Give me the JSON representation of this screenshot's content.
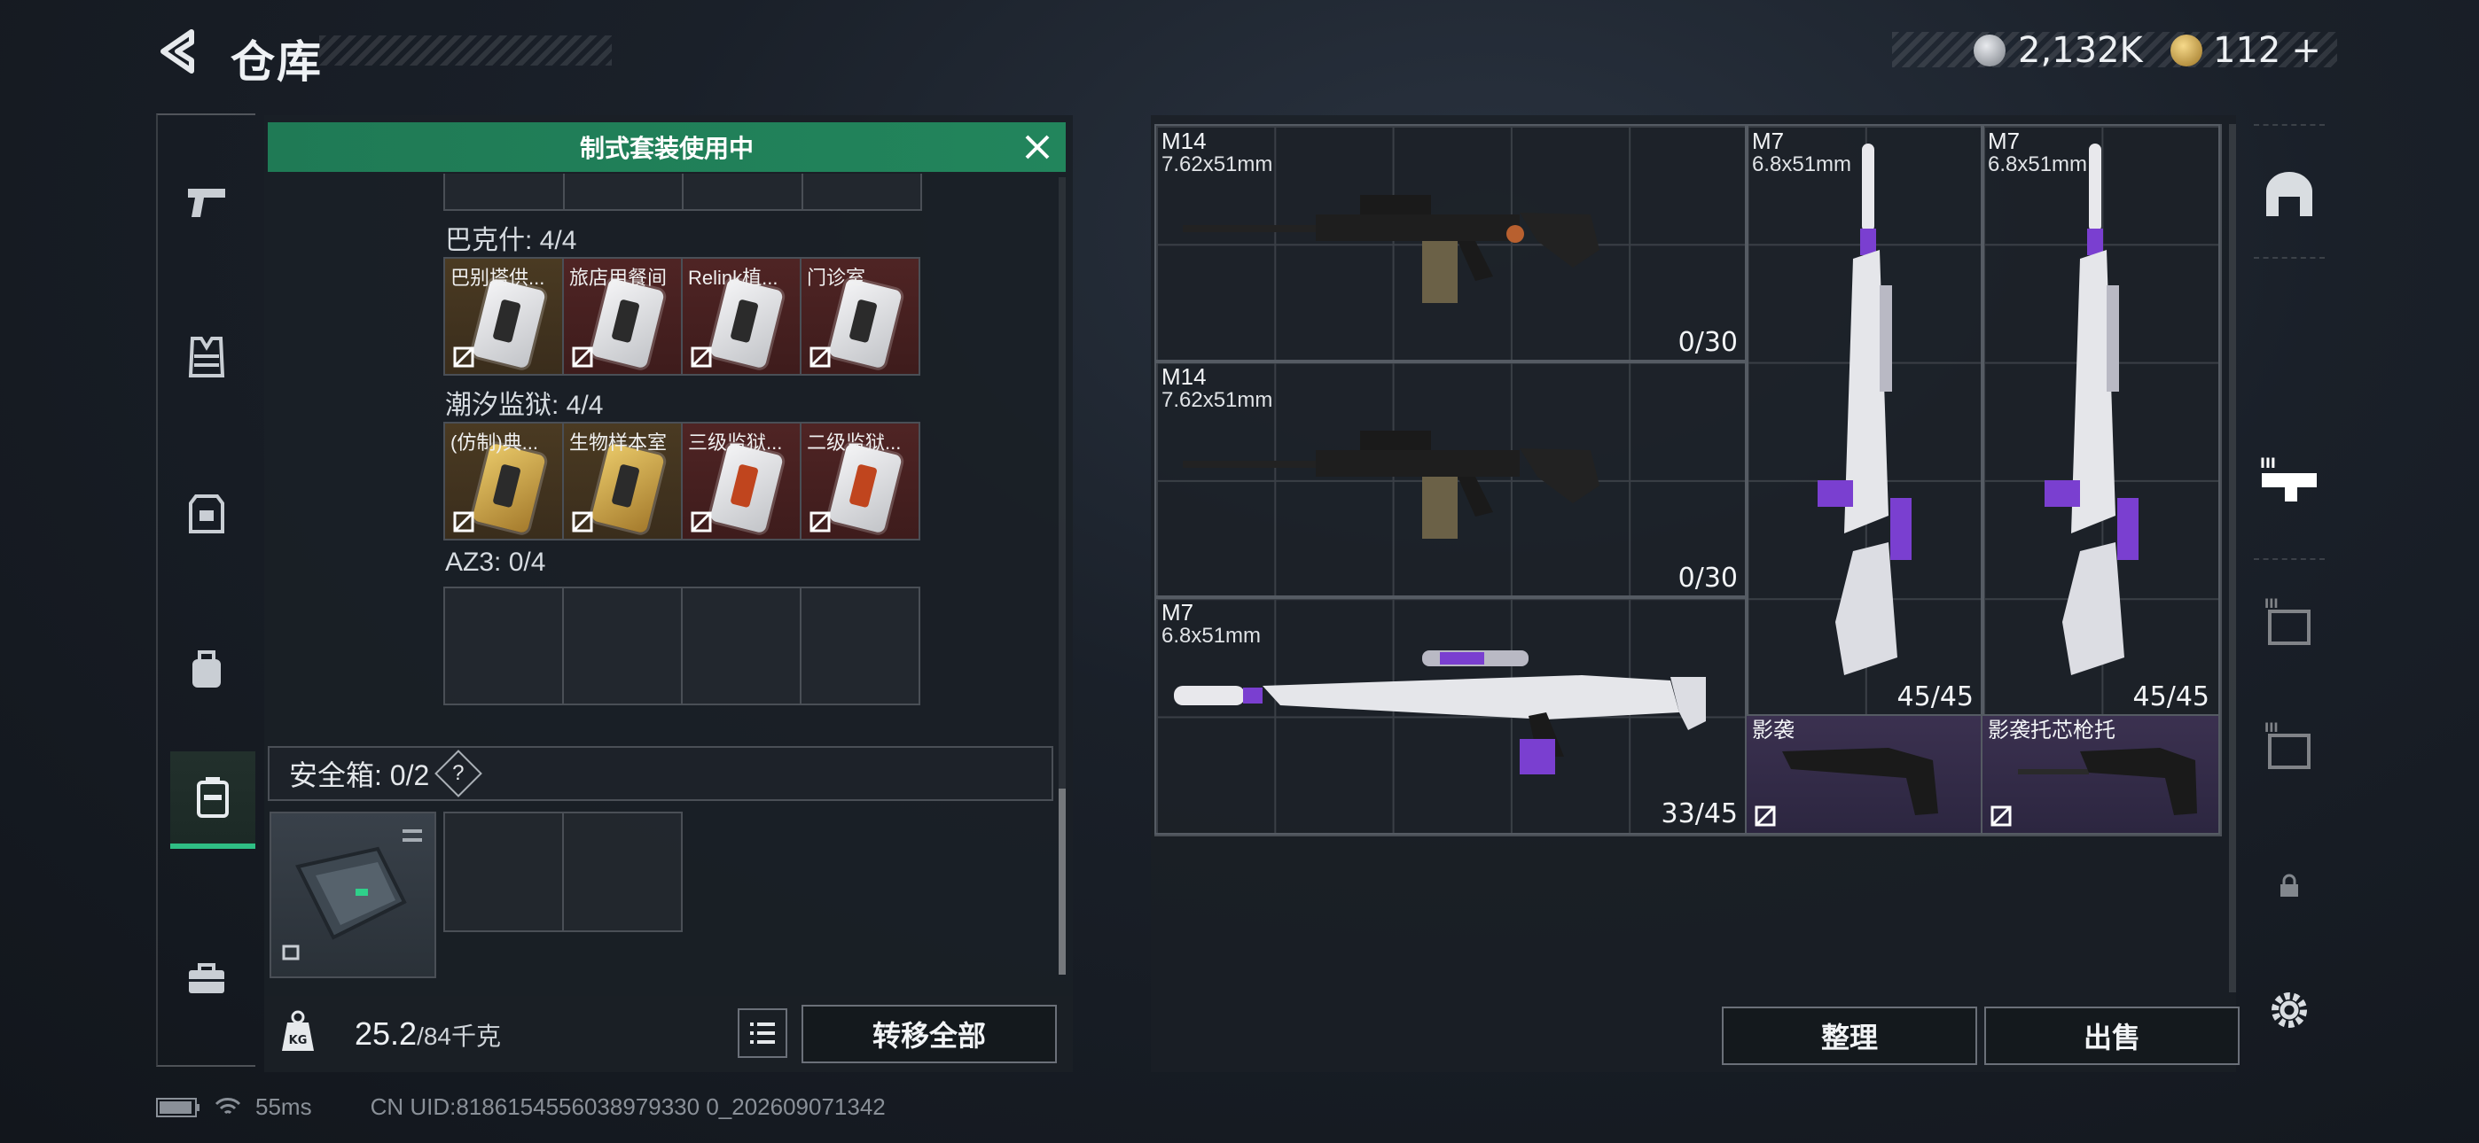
{
  "header": {
    "title": "仓库"
  },
  "currency": [
    {
      "icon": "silver-coin-icon",
      "value": "2,132K"
    },
    {
      "icon": "gold-coin-icon",
      "value": "112",
      "add": "+"
    }
  ],
  "rail": [
    "pistol-icon",
    "vest-icon",
    "armor-icon",
    "backpack-icon",
    "case-icon",
    "toolbox-icon"
  ],
  "banner": {
    "text": "制式套装使用中"
  },
  "groups": [
    {
      "label": "巴克什: 4/4",
      "slots": [
        {
          "name": "巴别塔供...",
          "style": "gold"
        },
        {
          "name": "旅店用餐间",
          "style": "red"
        },
        {
          "name": "Relink植...",
          "style": "red"
        },
        {
          "name": "门诊室",
          "style": "red"
        }
      ]
    },
    {
      "label": "潮汐监狱: 4/4",
      "slots": [
        {
          "name": "(仿制)典...",
          "style": "gold"
        },
        {
          "name": "生物样本室",
          "style": "gold"
        },
        {
          "name": "三级监狱...",
          "style": "red"
        },
        {
          "name": "二级监狱...",
          "style": "red"
        }
      ]
    },
    {
      "label": "AZ3: 0/4",
      "slots": []
    }
  ],
  "safe_box": {
    "label": "安全箱: 0/2",
    "help": "?"
  },
  "bottom": {
    "weight": "25.2",
    "weight_max": "/84千克",
    "transfer_all": "转移全部"
  },
  "weapons": [
    {
      "name": "M14",
      "caliber": "7.62x51mm",
      "ammo": "0/30"
    },
    {
      "name": "M14",
      "caliber": "7.62x51mm",
      "ammo": "0/30"
    },
    {
      "name": "M7",
      "caliber": "6.8x51mm",
      "ammo": "33/45"
    },
    {
      "name": "M7",
      "caliber": "6.8x51mm",
      "ammo": "45/45"
    },
    {
      "name": "M7",
      "caliber": "6.8x51mm",
      "ammo": "45/45"
    },
    {
      "name": "影袭",
      "caliber": "",
      "ammo": ""
    },
    {
      "name": "影袭托芯枪托",
      "caliber": "",
      "ammo": ""
    }
  ],
  "actions": {
    "sort": "整理",
    "sell": "出售"
  },
  "status": {
    "ping": "55ms",
    "uid": "CN UID:8186154556038979330 0_202609071342"
  },
  "colors": {
    "accent": "#22855c",
    "gold_slot": "#4a3a22",
    "red_slot": "#4f2424",
    "purple": "#7a3fd0"
  }
}
